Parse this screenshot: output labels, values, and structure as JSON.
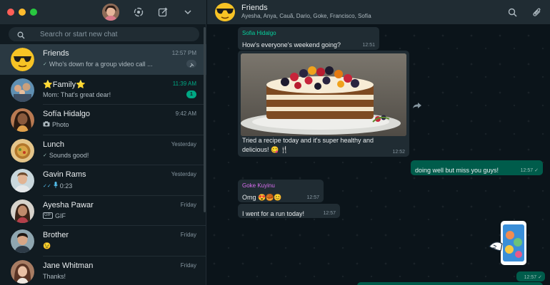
{
  "sidebar": {
    "search_placeholder": "Search or start new chat",
    "chats": [
      {
        "name": "Friends",
        "time": "12:57 PM",
        "preview": "Who's down for a group video call ...",
        "status": "read",
        "pinned": true,
        "active": true
      },
      {
        "name": "⭐Family⭐",
        "time": "11:39 AM",
        "preview": "Mom: That's great dear!",
        "unread": "1",
        "time_highlight": true
      },
      {
        "name": "Sofía Hidalgo",
        "time": "9:42 AM",
        "preview": "Photo",
        "media": "camera-icon"
      },
      {
        "name": "Lunch",
        "time": "Yesterday",
        "preview": "Sounds good!",
        "status": "read"
      },
      {
        "name": "Gavin Rams",
        "time": "Yesterday",
        "preview": "0:23",
        "status": "read",
        "media": "mic-icon"
      },
      {
        "name": "Ayesha Pawar",
        "time": "Friday",
        "preview": "GIF",
        "media": "gif-icon"
      },
      {
        "name": "Brother",
        "time": "Friday",
        "preview": "😉"
      },
      {
        "name": "Jane Whitman",
        "time": "Friday",
        "preview": "Thanks!"
      }
    ]
  },
  "conversation": {
    "title": "Friends",
    "members": "Ayesha, Anya, Cauã, Dario, Goke, Francisco, Sofía",
    "messages": [
      {
        "sender": "Sofia Hidalgo",
        "sender_color": "#06cf9c",
        "text": "How's everyone's weekend going?",
        "time": "12:51"
      },
      {
        "text": "Tried a recipe today and it's super healthy and",
        "text2": "delicious! 😋 🍴",
        "time": "12:52",
        "media": "cake-photo"
      },
      {
        "text": "doing well but miss you guys!",
        "time": "12:57",
        "outgoing": true
      },
      {
        "sender": "Goke Kuyinu",
        "sender_color": "#d86eef",
        "text": "Omg 😍🥮😊",
        "time": "12:57"
      },
      {
        "text": "I went for a run today!",
        "time": "12:57"
      },
      {
        "time": "12:57",
        "outgoing": true,
        "media": "sticker"
      }
    ]
  },
  "colors": {
    "accent": "#00a884",
    "sidebar_bg": "#111b21",
    "header_bg": "#202c33",
    "incoming_bubble": "#202c33",
    "outgoing_bubble": "#005c4b"
  }
}
